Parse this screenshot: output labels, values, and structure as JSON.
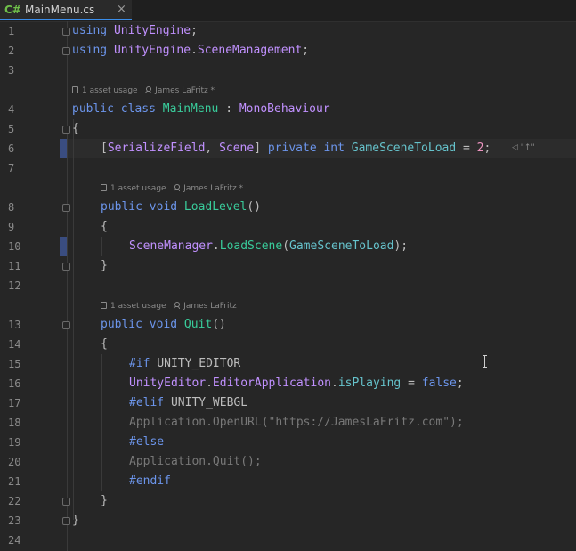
{
  "tab": {
    "lang": "C#",
    "title": "MainMenu.cs",
    "close": "×"
  },
  "lines": [
    "1",
    "2",
    "3",
    "4",
    "5",
    "6",
    "7",
    "8",
    "9",
    "10",
    "11",
    "12",
    "13",
    "14",
    "15",
    "16",
    "17",
    "18",
    "19",
    "20",
    "21",
    "22",
    "23",
    "24"
  ],
  "hints": {
    "class_usage": "1 asset usage",
    "class_author": "James LaFritz *",
    "load_usage": "1 asset usage",
    "load_author": "James LaFritz *",
    "quit_usage": "1 asset usage",
    "quit_author": "James LaFritz"
  },
  "inline_hint": "◁ \"↑\"",
  "code": {
    "l1_kw": "using ",
    "l1_ns": "UnityEngine",
    "l1_end": ";",
    "l2_kw": "using ",
    "l2_ns1": "UnityEngine",
    "l2_dot": ".",
    "l2_ns2": "SceneManagement",
    "l2_end": ";",
    "l4_kw": "public class ",
    "l4_name": "MainMenu",
    "l4_colon": " : ",
    "l4_base": "MonoBehaviour",
    "l5": "{",
    "l6_open": "[",
    "l6_attr1": "SerializeField",
    "l6_comma": ", ",
    "l6_attr2": "Scene",
    "l6_close": "] ",
    "l6_kw": "private int ",
    "l6_field": "GameSceneToLoad",
    "l6_eq": " = ",
    "l6_num": "2",
    "l6_end": ";",
    "l8_kw": "public void ",
    "l8_name": "LoadLevel",
    "l8_paren": "()",
    "l9": "{",
    "l10_cls": "SceneManager",
    "l10_dot": ".",
    "l10_method": "LoadScene",
    "l10_open": "(",
    "l10_arg": "GameSceneToLoad",
    "l10_close": ");",
    "l11": "}",
    "l13_kw": "public void ",
    "l13_name": "Quit",
    "l13_paren": "()",
    "l14": "{",
    "l15_pre": "#if ",
    "l15_sym": "UNITY_EDITOR",
    "l16_cls": "UnityEditor",
    "l16_dot1": ".",
    "l16_cls2": "EditorApplication",
    "l16_dot2": ".",
    "l16_prop": "isPlaying",
    "l16_eq": " = ",
    "l16_val": "false",
    "l16_end": ";",
    "l17_pre": "#elif ",
    "l17_sym": "UNITY_WEBGL",
    "l18": "Application.OpenURL(\"https://JamesLaFritz.com\");",
    "l19": "#else",
    "l20": "Application.Quit();",
    "l21": "#endif",
    "l22": "}",
    "l23": "}"
  }
}
